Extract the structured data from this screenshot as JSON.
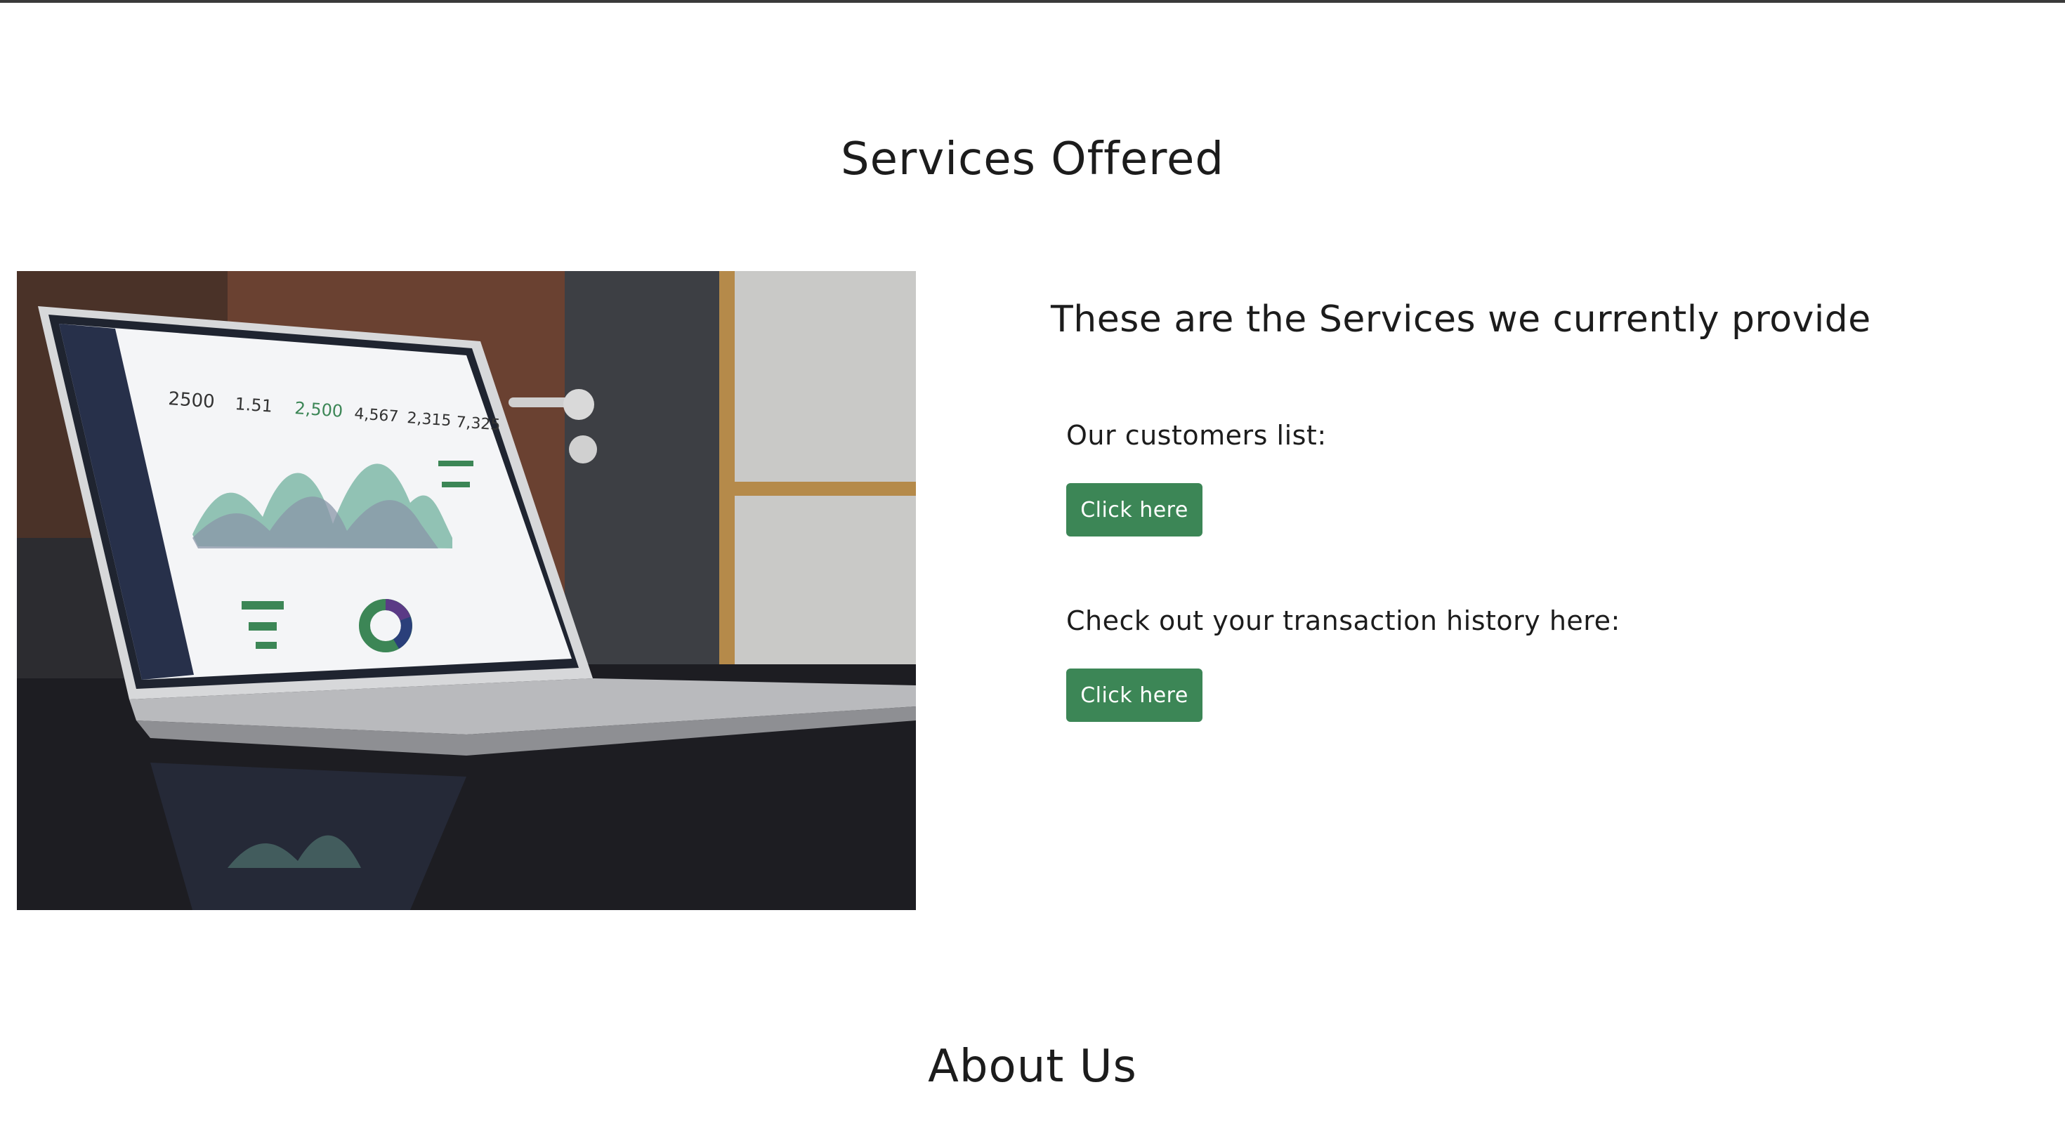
{
  "services": {
    "title": "Services Offered",
    "heading": "These are the Services we currently provide",
    "items": [
      {
        "label": "Our customers list:",
        "button_label": "Click here"
      },
      {
        "label": "Check out your transaction history here:",
        "button_label": "Click here"
      }
    ],
    "button_color": "#3c8656"
  },
  "photo": {
    "icon": "laptop-dashboard-photo"
  },
  "about": {
    "title": "About Us"
  }
}
